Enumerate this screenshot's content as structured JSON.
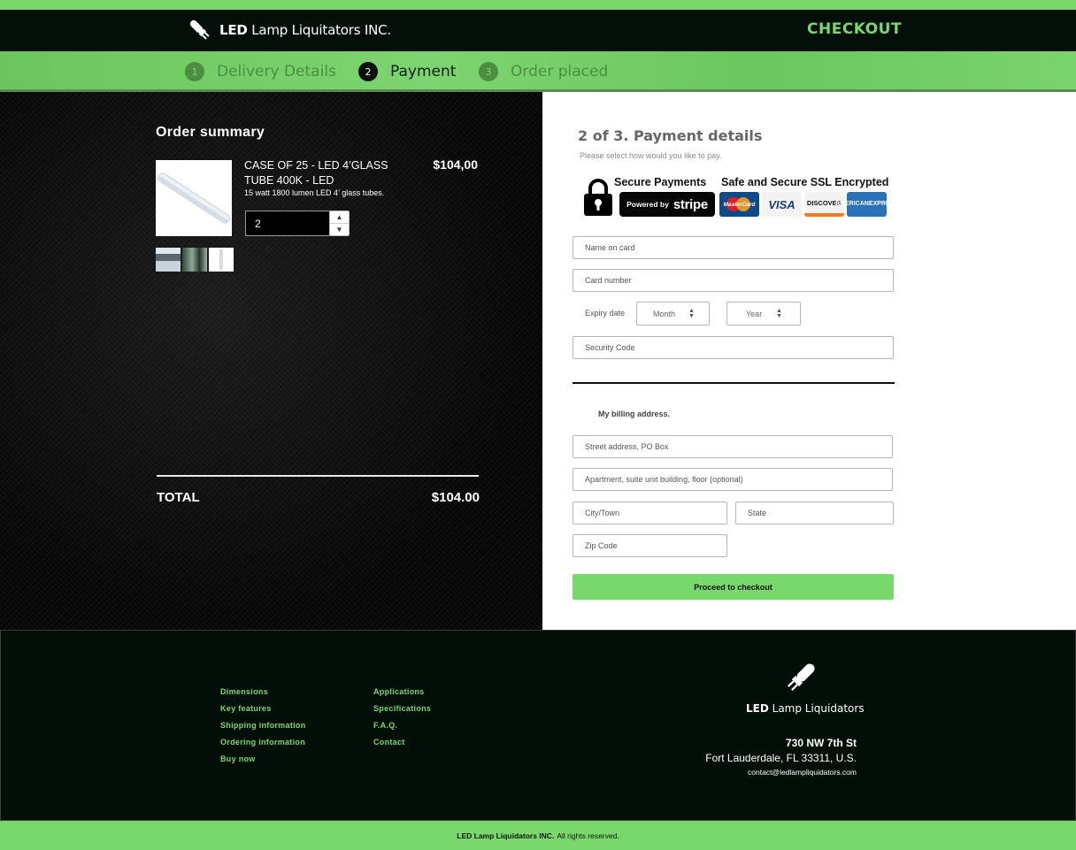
{
  "header": {
    "brand_bold": "LED",
    "brand_rest": " Lamp Liquitators INC.",
    "page_title": "CHECKOUT"
  },
  "steps": [
    {
      "number": "1",
      "label": "Delivery Details",
      "state": "inactive"
    },
    {
      "number": "2",
      "label": "Payment",
      "state": "active"
    },
    {
      "number": "3",
      "label": "Order placed",
      "state": "inactive"
    }
  ],
  "order_summary": {
    "title": "Order summary",
    "product": {
      "name": "CASE OF 25 - LED 4’GLASS TUBE 400K - LED",
      "description": "15 watt 1800 lumen LED 4’ glass tubes.",
      "price": "$104,00",
      "quantity": "2"
    },
    "total_label": "TOTAL",
    "total_value": "$104.00"
  },
  "payment": {
    "title": "2 of 3. Payment details",
    "subtitle": "Please select how would you like to pay.",
    "secure_payments": "Secure Payments",
    "powered_by": "Powered by",
    "stripe": "stripe",
    "ssl": "Safe and Secure SSL Encrypted",
    "cards": {
      "mastercard": "MasterCard",
      "visa": "VISA",
      "discover": "DISCOVER",
      "amex_line1": "AMERICAN",
      "amex_line2": "EXPRESS"
    },
    "name_placeholder": "Name on card",
    "card_placeholder": "Card number",
    "expiry_label": "Expiry date",
    "month": "Month",
    "year": "Year",
    "security_placeholder": "Security Code",
    "billing_title": "My billing address.",
    "street_placeholder": "Street address, PO Box",
    "apt_placeholder": "Apartment, suite unit building, floor (optional)",
    "city_placeholder": "City/Town",
    "state_placeholder": "State",
    "zip_placeholder": "Zip Code",
    "proceed_label": "Proceed to checkout"
  },
  "footer": {
    "col1": [
      "Dimensions",
      "Key features",
      "Shipping information",
      "Ordering information",
      "Buy now"
    ],
    "col2": [
      "Applications",
      "Specifications",
      "F.A.Q.",
      "Contact"
    ],
    "brand_bold": "LED",
    "brand_rest": " Lamp Liquidators",
    "address_line1": "730 NW 7th St",
    "address_line2": "Fort Lauderdale, FL 33311, U.S.",
    "email": "contact@ledlampliquidators.com",
    "copyright_bold": "LED Lamp Liquidators INC.",
    "copyright_rest": "All rights reserved."
  },
  "colors": {
    "accent": "#79d86b",
    "dark": "#040f0a"
  }
}
